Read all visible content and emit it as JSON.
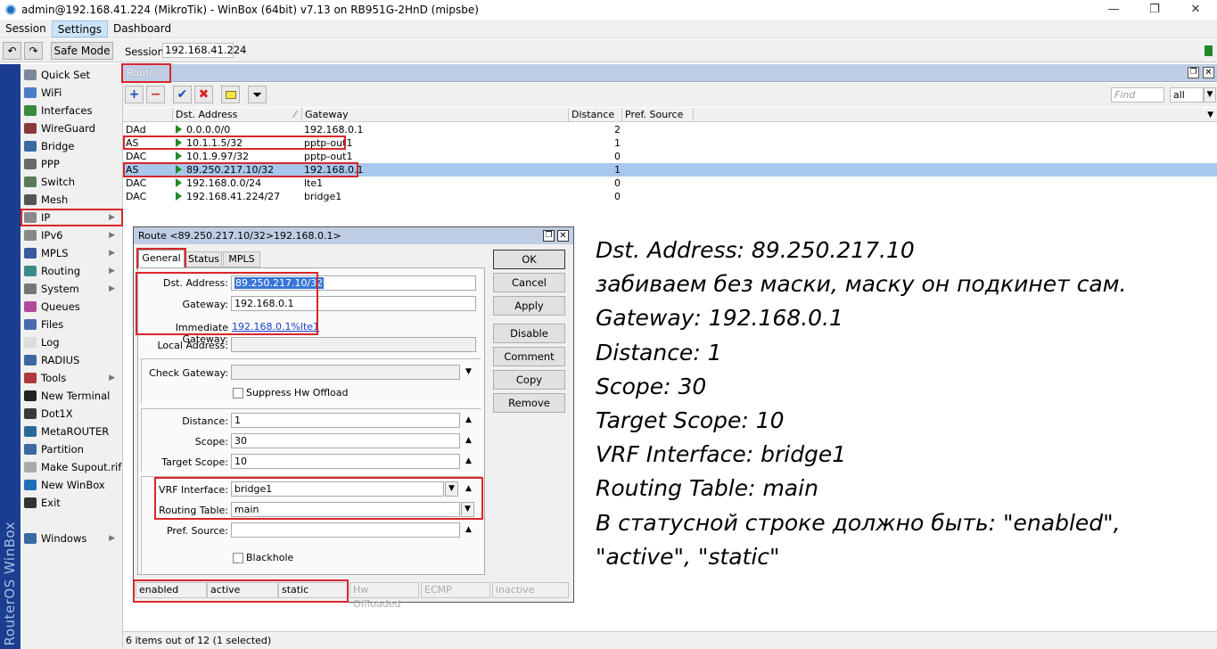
{
  "window": {
    "title": "admin@192.168.41.224 (MikroTik) - WinBox (64bit) v7.13 on RB951G-2HnD (mipsbe)",
    "minimize": "—",
    "maximize": "❐",
    "close": "✕"
  },
  "menubar": {
    "items": [
      "Session",
      "Settings",
      "Dashboard"
    ]
  },
  "toolbar": {
    "undo": "↶",
    "redo": "↷",
    "safe_mode": "Safe Mode",
    "session_label": "Session:",
    "session_value": "192.168.41.224"
  },
  "brand": "RouterOS WinBox",
  "nav": {
    "items": [
      {
        "label": "Quick Set",
        "icon": "quick-set-icon",
        "color": "#7a8a9a"
      },
      {
        "label": "WiFi",
        "icon": "wifi-icon",
        "color": "#4a7cc7"
      },
      {
        "label": "Interfaces",
        "icon": "interfaces-icon",
        "color": "#3a8a3a"
      },
      {
        "label": "WireGuard",
        "icon": "wireguard-icon",
        "color": "#8a3a3a"
      },
      {
        "label": "Bridge",
        "icon": "bridge-icon",
        "color": "#3a6aa0"
      },
      {
        "label": "PPP",
        "icon": "ppp-icon",
        "color": "#6a6a6a"
      },
      {
        "label": "Switch",
        "icon": "switch-icon",
        "color": "#5a7a5a"
      },
      {
        "label": "Mesh",
        "icon": "mesh-icon",
        "color": "#555"
      },
      {
        "label": "IP",
        "icon": "ip-icon",
        "color": "#888",
        "arrow": "▶"
      },
      {
        "label": "IPv6",
        "icon": "ipv6-icon",
        "color": "#888",
        "arrow": "▶"
      },
      {
        "label": "MPLS",
        "icon": "mpls-icon",
        "color": "#3a5aa0",
        "arrow": "▶"
      },
      {
        "label": "Routing",
        "icon": "routing-icon",
        "color": "#3a8a8a",
        "arrow": "▶"
      },
      {
        "label": "System",
        "icon": "system-icon",
        "color": "#777",
        "arrow": "▶"
      },
      {
        "label": "Queues",
        "icon": "queues-icon",
        "color": "#b04a9a"
      },
      {
        "label": "Files",
        "icon": "files-icon",
        "color": "#4a6ab0"
      },
      {
        "label": "Log",
        "icon": "log-icon",
        "color": "#ddd"
      },
      {
        "label": "RADIUS",
        "icon": "radius-icon",
        "color": "#3a6aa0"
      },
      {
        "label": "Tools",
        "icon": "tools-icon",
        "color": "#b03a3a",
        "arrow": "▶"
      },
      {
        "label": "New Terminal",
        "icon": "terminal-icon",
        "color": "#222"
      },
      {
        "label": "Dot1X",
        "icon": "dot1x-icon",
        "color": "#3a3a3a"
      },
      {
        "label": "MetaROUTER",
        "icon": "metarouter-icon",
        "color": "#2a6a9a"
      },
      {
        "label": "Partition",
        "icon": "partition-icon",
        "color": "#3a6aa0"
      },
      {
        "label": "Make Supout.rif",
        "icon": "supout-icon",
        "color": "#aaa"
      },
      {
        "label": "New WinBox",
        "icon": "new-winbox-icon",
        "color": "#1f6fb8"
      },
      {
        "label": "Exit",
        "icon": "exit-icon",
        "color": "#333"
      },
      {
        "label": "Windows",
        "icon": "windows-icon",
        "color": "#3a6aa0",
        "arrow": "▶"
      }
    ]
  },
  "route_list": {
    "title": "Route List",
    "find_placeholder": "Find",
    "filter_value": "all",
    "columns": [
      "",
      "Dst. Address",
      "Gateway",
      "Distance",
      "Pref. Source"
    ],
    "rows": [
      {
        "flags": "DAd",
        "dst": "0.0.0.0/0",
        "gateway": "192.168.0.1",
        "distance": "2"
      },
      {
        "flags": "AS",
        "dst": "10.1.1.5/32",
        "gateway": "pptp-out1",
        "distance": "1"
      },
      {
        "flags": "DAC",
        "dst": "10.1.9.97/32",
        "gateway": "pptp-out1",
        "distance": "0"
      },
      {
        "flags": "AS",
        "dst": "89.250.217.10/32",
        "gateway": "192.168.0.1",
        "distance": "1"
      },
      {
        "flags": "DAC",
        "dst": "192.168.0.0/24",
        "gateway": "lte1",
        "distance": "0"
      },
      {
        "flags": "DAC",
        "dst": "192.168.41.224/27",
        "gateway": "bridge1",
        "distance": "0"
      }
    ],
    "status": "6 items out of 12 (1 selected)"
  },
  "route_dialog": {
    "title": "Route <89.250.217.10/32>192.168.0.1>",
    "tabs": [
      "General",
      "Status",
      "MPLS"
    ],
    "labels": {
      "dst": "Dst. Address:",
      "gateway": "Gateway:",
      "imm_gw": "Immediate Gateway:",
      "local": "Local Address:",
      "check_gw": "Check Gateway:",
      "suppress": "Suppress Hw Offload",
      "distance": "Distance:",
      "scope": "Scope:",
      "target_scope": "Target Scope:",
      "vrf": "VRF Interface:",
      "routing_table": "Routing Table:",
      "pref_source": "Pref. Source:",
      "blackhole": "Blackhole"
    },
    "values": {
      "dst": "89.250.217.10/32",
      "gateway": "192.168.0.1",
      "imm_gw": "192.168.0.1%lte1",
      "distance": "1",
      "scope": "30",
      "target_scope": "10",
      "vrf": "bridge1",
      "routing_table": "main"
    },
    "buttons": [
      "OK",
      "Cancel",
      "Apply",
      "Disable",
      "Comment",
      "Copy",
      "Remove"
    ],
    "status": [
      "enabled",
      "active",
      "static",
      "Hw Offloaded",
      "ECMP",
      "inactive"
    ]
  },
  "notes": [
    "Dst. Address: 89.250.217.10",
    "забиваем без маски, маску он подкинет сам.",
    "Gateway: 192.168.0.1",
    "Distance: 1",
    "Scope: 30",
    "Target Scope: 10",
    "VRF Interface: bridge1",
    "Routing Table: main",
    "В статусной строке должно быть: \"enabled\",",
    "\"active\", \"static\""
  ]
}
